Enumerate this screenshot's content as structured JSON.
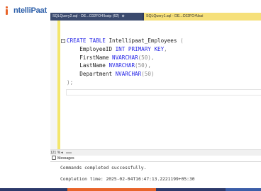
{
  "brand": {
    "logo_prefix": "I",
    "logo_text": "ntelliPaat"
  },
  "tabs": [
    {
      "label": "SQLQuery2.sql - DE...C02FO4\\Issip (62)",
      "close": "⊗"
    },
    {
      "label": "SQLQuery1.sql - DE...C02FO4\\Issi",
      "close": ""
    }
  ],
  "editor": {
    "collapse_symbol": "-",
    "lines": [
      {
        "kw1": "CREATE TABLE ",
        "name": "Intellipaat_Employees ",
        "punct": "("
      },
      {
        "indent": "    ",
        "col": "EmployeeID ",
        "type": "INT PRIMARY KEY",
        "punct": ","
      },
      {
        "indent": "    ",
        "col": "FirstName ",
        "type": "NVARCHAR",
        "arg": "(50)",
        "punct": ","
      },
      {
        "indent": "    ",
        "col": "LastName ",
        "type": "NVARCHAR",
        "arg": "(50)",
        "punct": ","
      },
      {
        "indent": "    ",
        "col": "Department ",
        "type": "NVARCHAR",
        "arg": "(50)",
        "punct": ""
      },
      {
        "close": ");"
      }
    ]
  },
  "status": {
    "zoom": "121 %",
    "arrow": "◂"
  },
  "messages": {
    "tab_label": "Messages",
    "line1": "Commands completed successfully.",
    "line2": "Completion time: 2025-02-04T16:47:13.2221199+05:30"
  },
  "footer_colors": [
    "#2d3a6b",
    "#e8642a",
    "#2d3a6b",
    "#3b5ea8"
  ]
}
